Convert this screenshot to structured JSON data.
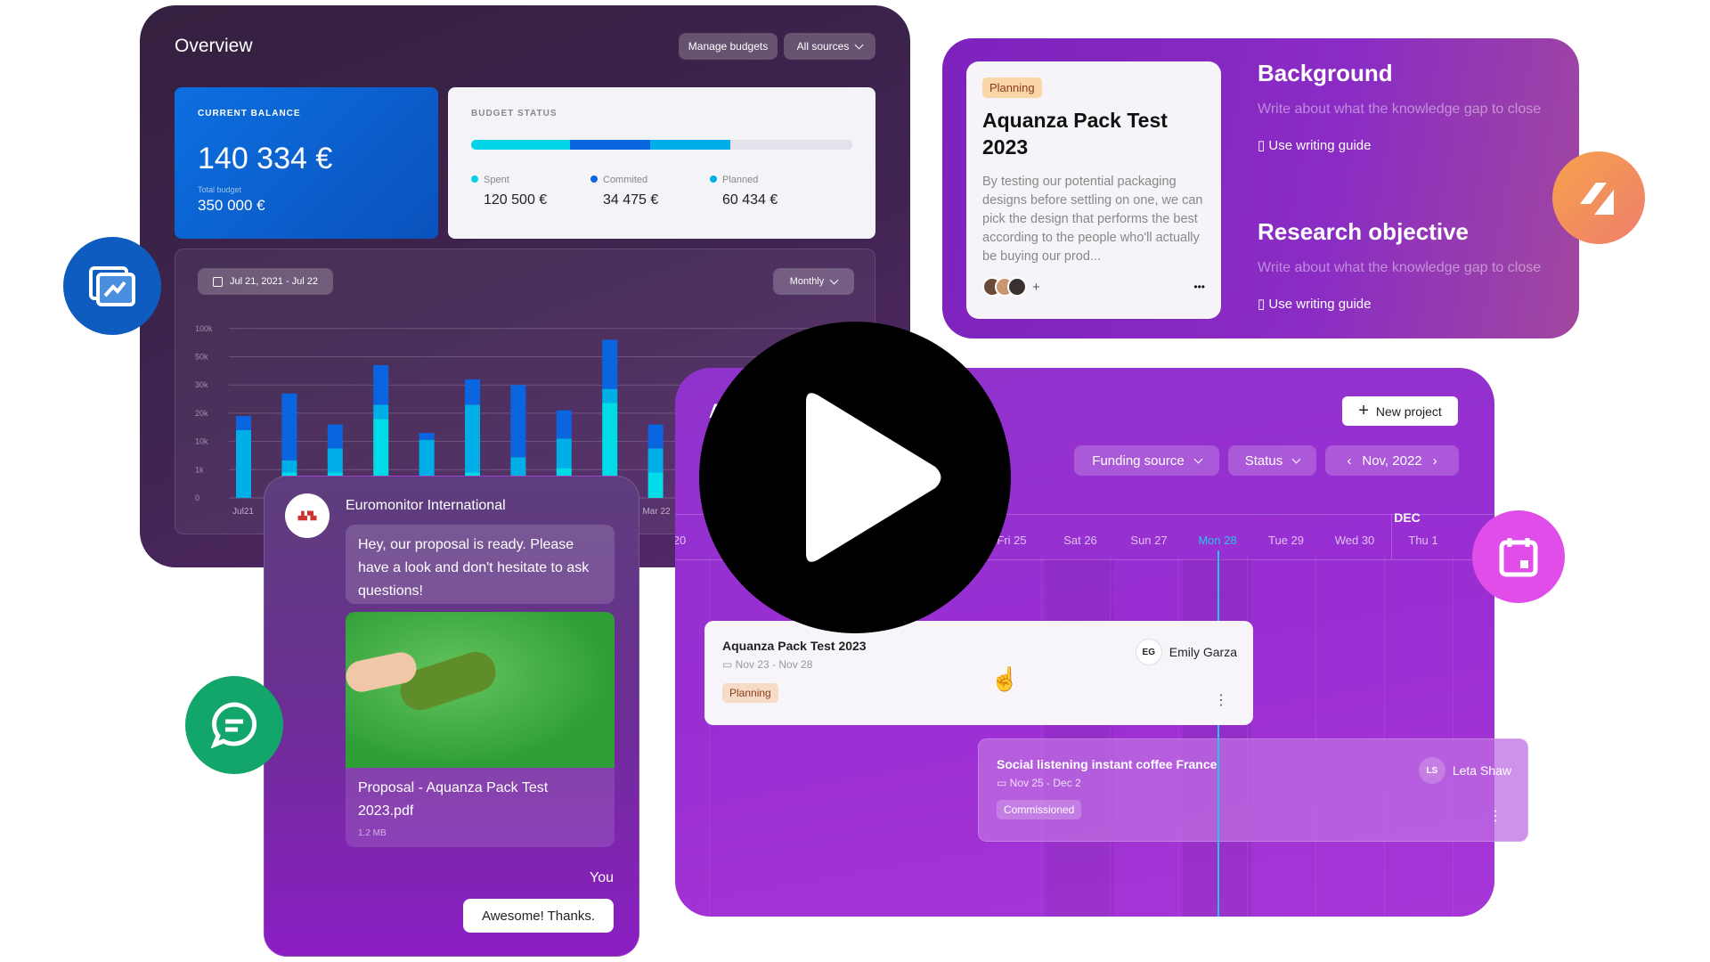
{
  "overview": {
    "title": "Overview",
    "manage_budgets": "Manage budgets",
    "all_sources": "All sources",
    "balance": {
      "label": "CURRENT BALANCE",
      "value": "140 334 €",
      "total_label": "Total budget",
      "total_value": "350 000 €"
    },
    "budget_status": {
      "label": "BUDGET STATUS",
      "progress": {
        "spent": 0.26,
        "committed": 0.21,
        "planned": 0.21
      },
      "items": [
        {
          "name": "Spent",
          "value": "120 500 €",
          "color": "#00d4e6"
        },
        {
          "name": "Commited",
          "value": "34 475 €",
          "color": "#0a66e0"
        },
        {
          "name": "Planned",
          "value": "60 434 €",
          "color": "#00aee8"
        }
      ]
    },
    "date_range": "Jul 21, 2021 - Jul 22",
    "period": "Monthly"
  },
  "chart_data": {
    "type": "bar",
    "stacked": true,
    "grid": true,
    "yticks": [
      "0",
      "1k",
      "10k",
      "20k",
      "30k",
      "50k",
      "100k"
    ],
    "ytick_values": [
      0,
      1000,
      10000,
      20000,
      30000,
      50000,
      100000
    ],
    "xtick_labels": [
      "Jul21",
      "Mar 22"
    ],
    "colors": [
      "#00dbe8",
      "#00aee8",
      "#0a66e0"
    ],
    "bars": [
      [
        0,
        14000,
        19000
      ],
      [
        900,
        4000,
        27000
      ],
      [
        900,
        7800,
        16000
      ],
      [
        18000,
        23000,
        44000
      ],
      [
        0,
        10600,
        13000
      ],
      [
        900,
        23000,
        34000
      ],
      [
        800,
        5000,
        30000
      ],
      [
        1500,
        11000,
        21000
      ],
      [
        23600,
        28600,
        80000
      ],
      [
        900,
        7800,
        16000
      ]
    ]
  },
  "research": {
    "tag": "Planning",
    "title": "Aquanza Pack Test 2023",
    "desc": "By testing our potential packaging designs before settling on one, we can pick the design that performs the best according to the people who'll actually be buying our prod...",
    "more": "•••",
    "plus": "+",
    "sections": [
      {
        "heading": "Background",
        "placeholder": "Write about what the knowledge gap to close",
        "guide": "Use writing guide"
      },
      {
        "heading": "Research objective",
        "placeholder": "Write about what the knowledge gap to close",
        "guide": "Use writing guide"
      }
    ]
  },
  "timeline": {
    "title_partial": "A",
    "new_project": "New project",
    "funding_source": "Funding source",
    "status": "Status",
    "month": "Nov, 2022",
    "month_next": "DEC",
    "days": [
      "20",
      "Fri 25",
      "Sat 26",
      "Sun 27",
      "Mon 28",
      "Tue 29",
      "Wed 30",
      "Thu 1"
    ],
    "today": "Mon 28",
    "today_color": "#22c7e6",
    "tasks": [
      {
        "title": "Aquanza Pack Test 2023",
        "dates": "Nov 23 - Nov 28",
        "status": "Planning",
        "initials": "EG",
        "owner": "Emily Garza"
      },
      {
        "title": "Social listening instant coffee France",
        "dates": "Nov 25 - Dec 2",
        "status": "Commissioned",
        "initials": "LS",
        "owner": "Leta Shaw"
      }
    ]
  },
  "chat": {
    "sender": "Euromonitor International",
    "message": "Hey, our proposal is ready. Please have a look and don't hesitate to ask questions!",
    "file_name": "Proposal - Aquanza Pack Test 2023.pdf",
    "file_size": "1.2 MB",
    "you_label": "You",
    "reply": "Awesome! Thanks."
  },
  "icons": {
    "blue": "chart-report-icon",
    "green": "chat-bubble-icon",
    "orange": "brand-logo-icon",
    "pink": "calendar-icon",
    "center": "play-icon"
  }
}
